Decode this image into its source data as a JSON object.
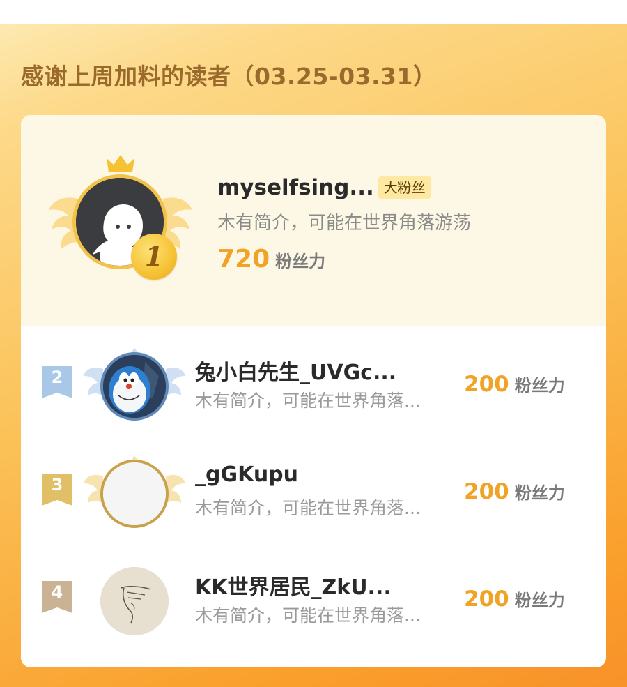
{
  "title": "感谢上周加料的读者（03.25-03.31）",
  "top_reader": {
    "rank": "1",
    "name": "myselfsing...",
    "badge": "大粉丝",
    "bio": "木有简介，可能在世界角落游荡",
    "score": "720",
    "score_unit": "粉丝力",
    "avatar_icon": "ghost-avatar-icon"
  },
  "readers": [
    {
      "rank": "2",
      "name": "兔小白先生_UVGc...",
      "bio": "木有简介，可能在世界角落...",
      "score": "200",
      "score_unit": "粉丝力",
      "avatar_icon": "doraemon-avatar-icon"
    },
    {
      "rank": "3",
      "name": "_gGKupu",
      "bio": "木有简介，可能在世界角落...",
      "score": "200",
      "score_unit": "粉丝力",
      "avatar_icon": "blank-avatar-icon"
    },
    {
      "rank": "4",
      "name": "KK世界居民_ZkU...",
      "bio": "木有简介，可能在世界角落...",
      "score": "200",
      "score_unit": "粉丝力",
      "avatar_icon": "sketch-face-avatar-icon"
    }
  ],
  "colors": {
    "accent": "#f0a326",
    "title": "#9a6a2c",
    "rank2": "#a9c8e8",
    "rank3": "#e1bf67",
    "rank4": "#c9b394"
  }
}
